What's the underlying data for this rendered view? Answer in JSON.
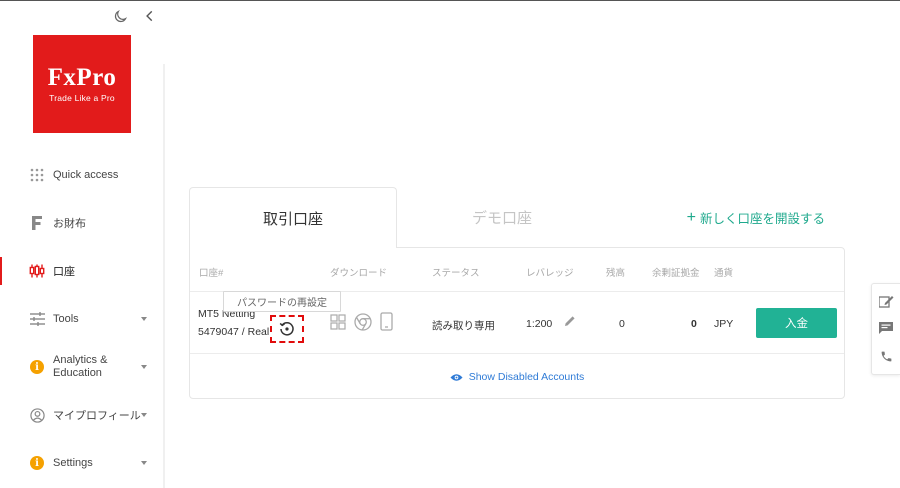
{
  "sidebar": {
    "logo": {
      "main": "FxPro",
      "tagline": "Trade Like a Pro"
    },
    "items": [
      {
        "label": "Quick access",
        "icon": "grid-icon"
      },
      {
        "label": "お財布",
        "icon": "wallet-f-icon"
      },
      {
        "label": "口座",
        "icon": "candlestick-icon",
        "active": true
      },
      {
        "label": "Tools",
        "icon": "sliders-icon"
      },
      {
        "label": "Analytics &",
        "label2": "Education",
        "icon": "info-icon"
      },
      {
        "label": "マイプロフィール",
        "icon": "user-icon"
      },
      {
        "label": "Settings",
        "icon": "info-icon"
      }
    ]
  },
  "tabs": {
    "live": "取引口座",
    "demo": "デモ口座",
    "open_account": "新しく口座を開設する"
  },
  "table": {
    "headers": [
      "口座#",
      "ダウンロード",
      "ステータス",
      "レバレッジ",
      "残高",
      "余剰証拠金",
      "通貨"
    ],
    "rows": [
      {
        "account_name": "MT5 Netting",
        "account_number": "5479047 / Real",
        "status": "読み取り専用",
        "leverage": "1:200",
        "balance": "0",
        "free_margin": "0",
        "currency": "JPY",
        "deposit_label": "入金"
      }
    ],
    "tooltip": "パスワードの再設定",
    "show_disabled": "Show Disabled Accounts"
  },
  "colors": {
    "brand_red": "#e21b1b",
    "accent_green": "#21b295",
    "link_blue": "#2f7bd6",
    "warning_orange": "#f5a100"
  }
}
